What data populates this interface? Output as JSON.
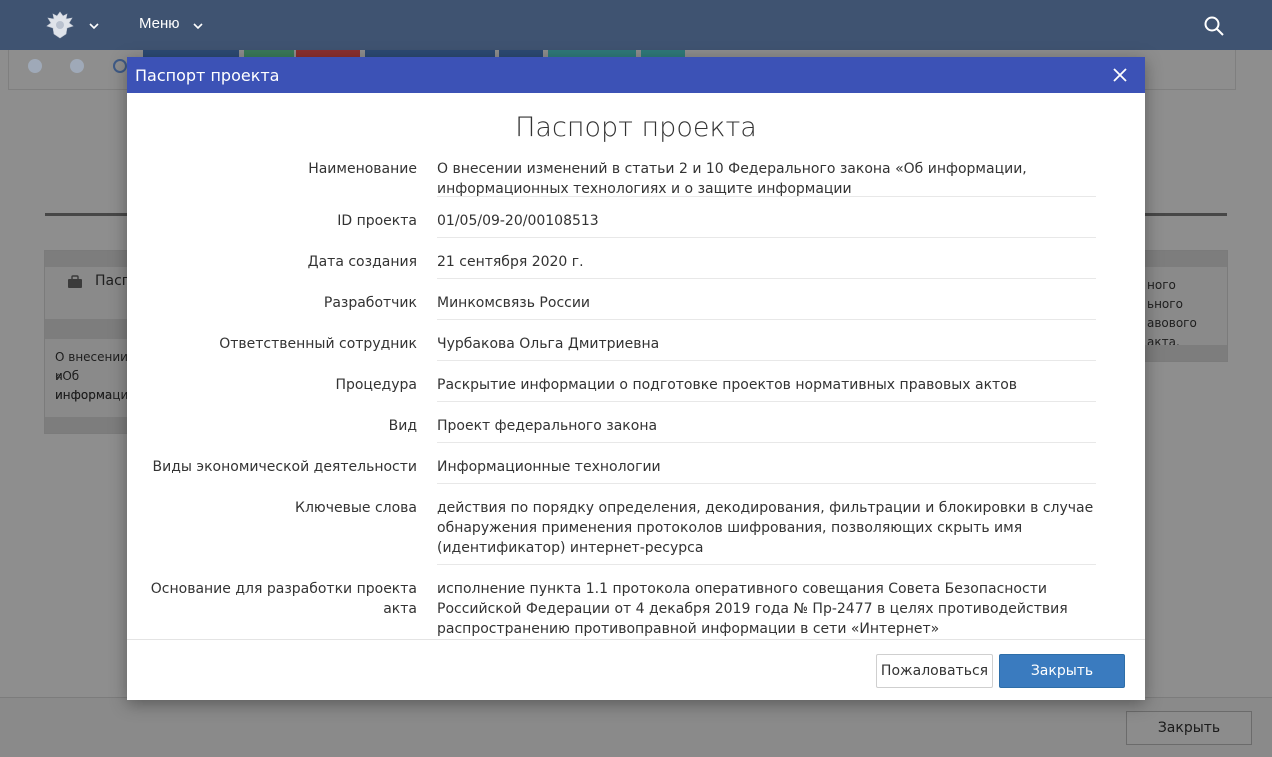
{
  "header": {
    "menu_label": "Меню"
  },
  "background": {
    "card_left_header": "Пасп",
    "card_left_text": [
      "О внесении и",
      "«Об информа",
      "информации"
    ],
    "card_right_text": [
      "ного",
      "ьного",
      "авового акта."
    ],
    "footer_close_label": "Закрыть"
  },
  "modal": {
    "title": "Паспорт проекта",
    "heading": "Паспорт проекта",
    "fields": [
      {
        "label": "Наименование",
        "value": "О внесении изменений в статьи 2 и 10 Федерального закона «Об информации, информационных технологиях и о защите информации"
      },
      {
        "label": "ID проекта",
        "value": "01/05/09-20/00108513"
      },
      {
        "label": "Дата создания",
        "value": "21 сентября 2020 г."
      },
      {
        "label": "Разработчик",
        "value": "Минкомсвязь России"
      },
      {
        "label": "Ответственный сотрудник",
        "value": "Чурбакова Ольга Дмитриевна"
      },
      {
        "label": "Процедура",
        "value": "Раскрытие информации о подготовке проектов нормативных правовых актов"
      },
      {
        "label": "Вид",
        "value": "Проект федерального закона"
      },
      {
        "label": "Виды экономической деятельности",
        "value": "Информационные технологии"
      },
      {
        "label": "Ключевые слова",
        "value": "действия по порядку определения, декодирования, фильтрации и блокировки в случае обнаружения применения протоколов шифрования, позволяющих скрыть имя (идентификатор) интернет-ресурса"
      },
      {
        "label": "Основание для разработки проекта акта",
        "value": "исполнение пункта 1.1 протокола оперативного совещания Совета Безопасности Российской Федерации от 4 декабря 2019 года № Пр-2477 в целях противодействия распространению противоправной информации в сети «Интернет»"
      }
    ],
    "complain_label": "Пожаловаться",
    "close_label": "Закрыть"
  }
}
